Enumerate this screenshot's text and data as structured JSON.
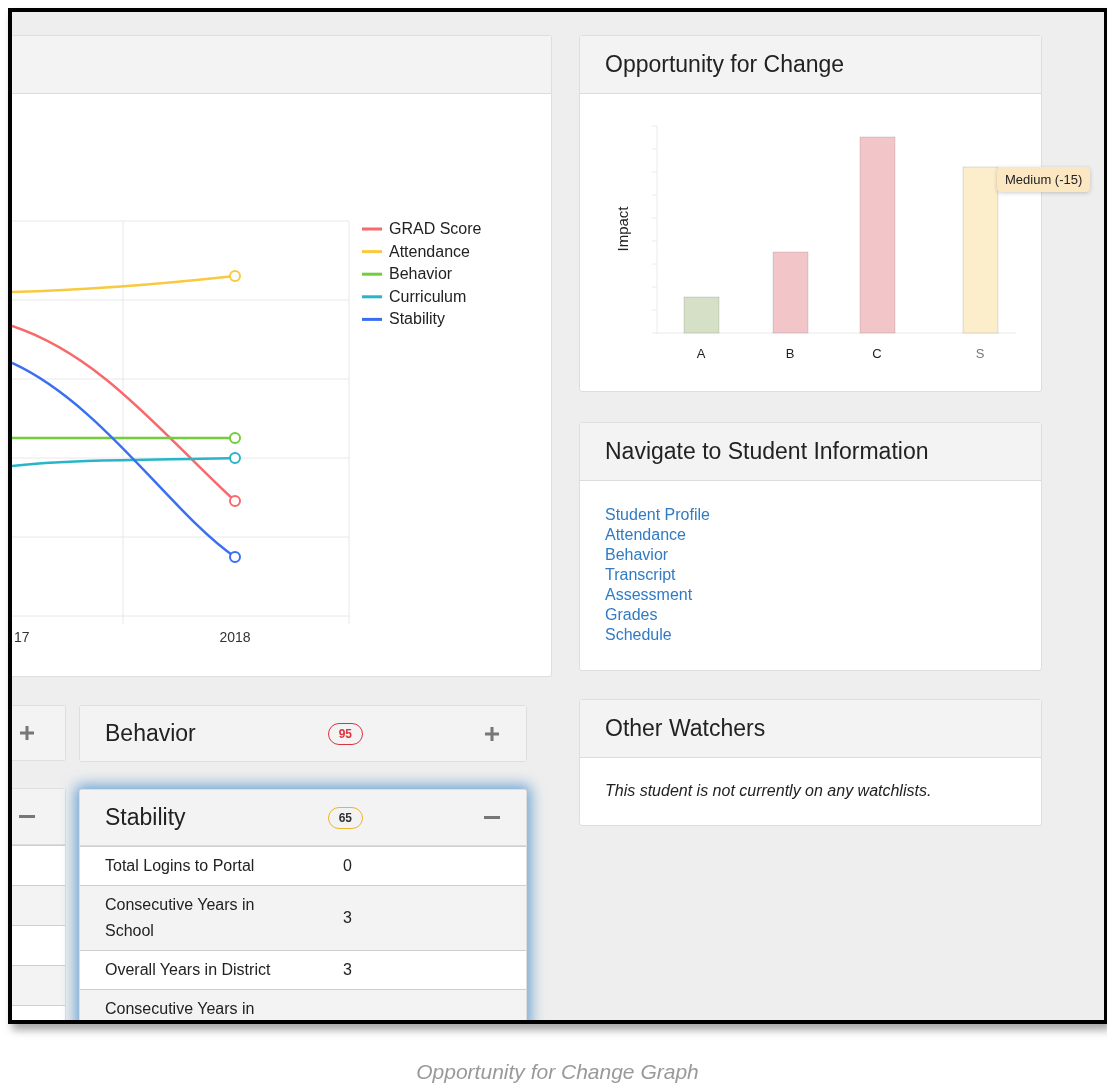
{
  "trend_panel": {
    "legend": [
      {
        "name": "GRAD Score",
        "color": "#f8696b"
      },
      {
        "name": "Attendance",
        "color": "#f9c940"
      },
      {
        "name": "Behavior",
        "color": "#72cc3c"
      },
      {
        "name": "Curriculum",
        "color": "#27b5c7"
      },
      {
        "name": "Stability",
        "color": "#3a6ff3"
      }
    ],
    "x_labels": [
      "17",
      "2018"
    ]
  },
  "cut_cards": [
    {
      "expanded": false
    },
    {
      "expanded": true
    }
  ],
  "score_cards": [
    {
      "title": "Behavior",
      "score": "95",
      "color": "#d9343f",
      "expanded": false,
      "highlighted": false
    },
    {
      "title": "Stability",
      "score": "65",
      "color": "#f0b429",
      "expanded": true,
      "highlighted": true,
      "rows": [
        {
          "label": "Total Logins to Portal",
          "value": "0"
        },
        {
          "label": "Consecutive Years in School",
          "value": "3"
        },
        {
          "label": "Overall Years in District",
          "value": "3"
        },
        {
          "label": "Consecutive Years in"
        }
      ]
    }
  ],
  "opportunity": {
    "title": "Opportunity for Change",
    "ylabel": "Impact",
    "bars": [
      {
        "category": "A",
        "color": "#d6e0c6"
      },
      {
        "category": "B",
        "color": "#f2c6c9"
      },
      {
        "category": "C",
        "color": "#f2c6c9"
      },
      {
        "category": "S",
        "color": "#fcedcb"
      }
    ],
    "tooltip": "Medium (-15)"
  },
  "navigate": {
    "title": "Navigate to Student Information",
    "links": [
      "Student Profile",
      "Attendance",
      "Behavior",
      "Transcript",
      "Assessment",
      "Grades",
      "Schedule"
    ]
  },
  "watchers": {
    "title": "Other Watchers",
    "message": "This student is not currently on any watchlists."
  },
  "caption": "Opportunity for Change Graph"
}
